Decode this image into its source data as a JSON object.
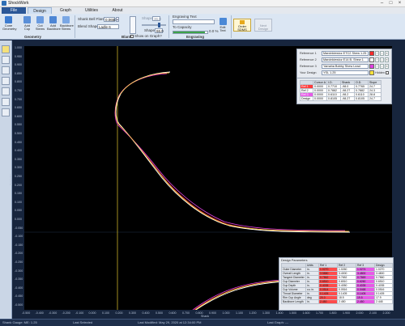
{
  "app": {
    "title": "ShockWork"
  },
  "tabs": [
    {
      "label": "File"
    },
    {
      "label": "Design"
    },
    {
      "label": "Graph"
    },
    {
      "label": "Utilities"
    },
    {
      "label": "About"
    }
  ],
  "ribbon": {
    "buttons": [
      {
        "label": "Cone Geometry"
      },
      {
        "label": "Add Cup"
      },
      {
        "label": "Cut Stems"
      },
      {
        "label": "Add Backbore"
      },
      {
        "label": "Backbore Stems"
      }
    ],
    "group_geometry": "Geometry",
    "shank_label": "Shank Bell Flare:",
    "shank_value": "0.0650",
    "blend_label": "Blend Shape:",
    "blend_value": "Ladle 6",
    "shape_label": "Shape:",
    "shape_value": "36.0",
    "shape2_label": "Shape:",
    "shape2_value": "66.0",
    "group_blank": "Blank",
    "show_origin": "Show on Graph?",
    "eng_title": "Engraving Text",
    "eng_capacity": "To Capacity",
    "eng_progress": 0.92,
    "eng_percent": "0.0 %",
    "eng_button": "Edit Text",
    "group_engraving": "Engraving",
    "order_button": "Order SDMS",
    "next_button": "Next Design"
  },
  "axes": {
    "x_ticks": [
      "-0.500",
      "-0.400",
      "-0.300",
      "-0.200",
      "-0.100",
      "0.000",
      "0.100",
      "0.200",
      "0.300",
      "0.400",
      "0.500",
      "0.600",
      "0.700",
      "0.800",
      "0.900",
      "1.000",
      "1.100",
      "1.200",
      "1.300",
      "1.400",
      "1.500",
      "1.600",
      "1.700",
      "1.800",
      "1.900",
      "2.000",
      "2.100",
      "2.200"
    ],
    "y_ticks": [
      "1.000",
      "0.950",
      "0.900",
      "0.850",
      "0.800",
      "0.750",
      "0.700",
      "0.650",
      "0.600",
      "0.550",
      "0.500",
      "0.450",
      "0.400",
      "0.350",
      "0.300",
      "0.250",
      "0.200",
      "0.150",
      "0.100",
      "0.050",
      "0.000",
      "-0.050",
      "-0.100",
      "-0.150",
      "-0.200",
      "-0.250",
      "-0.300",
      "-0.350",
      "-0.400",
      "-0.450",
      "-0.500"
    ],
    "x_label": "Shank",
    "y_label": "Diameter"
  },
  "reference_panel": {
    "rows": [
      {
        "label": "Reference 1",
        "value": "Marcinkiewicz ETC2 Shew 1.25",
        "color": "#ff2a2a"
      },
      {
        "label": "Reference 2",
        "value": "Marcinkiewicz E14 B. Shew 1",
        "color": "#ffffff"
      },
      {
        "label": "Reference 3",
        "value": "Yamaha Bobby Shew Lead",
        "color": "#e03fe0"
      },
      {
        "label": "Your Design",
        "value": "YSL 1.25",
        "color": "#ffe23a",
        "extra": "Hidden"
      }
    ]
  },
  "compare_table": {
    "header": [
      "",
      "Cursor ∆",
      "I.D.",
      "Shank",
      "O.D.",
      "Slope"
    ],
    "rows": [
      {
        "name": "Ref 1",
        "cells": [
          "0.0000",
          "0.7710",
          "-98.0",
          "0.7765",
          "24.7"
        ],
        "color": "#ff3c3c"
      },
      {
        "name": "Ref 2",
        "cells": [
          "0.0000",
          "0.7882",
          "-98.27",
          "0.7882",
          "24.3"
        ],
        "color": "#ffffff"
      },
      {
        "name": "Ref 3",
        "cells": [
          "0.0000",
          "0.6110",
          "-98.2",
          "0.6110",
          "28.8"
        ],
        "color": "#e85ae8"
      },
      {
        "name": "Design",
        "cells": [
          "0.0000",
          "0.8105",
          "-98.27",
          "0.8105",
          "24.7"
        ],
        "color": "#ffffff"
      }
    ]
  },
  "design_panel": {
    "title": "Design Parameters",
    "header": [
      "",
      "Units",
      "Ref 1",
      "Ref 2",
      "Ref 3",
      "Design"
    ],
    "rows": [
      {
        "name": "Outer Diameter",
        "unit": "in.",
        "v": [
          "1.0270",
          "1.0260",
          "1.0274",
          "1.0270"
        ]
      },
      {
        "name": "Overall Length",
        "unit": "in.",
        "v": [
          "3.5880",
          "3.4000",
          "3.4800",
          "3.4800"
        ]
      },
      {
        "name": "Tangent Diameter",
        "unit": "in.",
        "v": [
          "0.7862",
          "0.7652",
          "0.7869",
          "0.7860"
        ]
      },
      {
        "name": "Cup Diameter",
        "unit": "in.",
        "v": [
          "0.6510",
          "0.6510",
          "0.6260",
          "0.6510"
        ]
      },
      {
        "name": "Cup Depth",
        "unit": "in.",
        "v": [
          "0.4035",
          "0.4050",
          "0.4035",
          "0.4035"
        ]
      },
      {
        "name": "Cup Volume",
        "unit": "cu. in.",
        "v": [
          "0.0514",
          "0.0516",
          "0.0468",
          "0.0516"
        ]
      },
      {
        "name": "Throat Diameter",
        "unit": "in.",
        "v": [
          "0.1405",
          "0.1405",
          "0.1405",
          "0.1405"
        ]
      },
      {
        "name": "Rim Cup Angle",
        "unit": "deg",
        "v": [
          "20.0",
          "18.5",
          "19.5",
          "17.9"
        ]
      },
      {
        "name": "Backbore Length",
        "unit": "in.",
        "v": [
          "2.450",
          "2.450",
          "2.450",
          "2.448"
        ]
      }
    ]
  },
  "status": {
    "left": "Shank Gauge: ME: 1.25",
    "mid": "Last Selected",
    "right1": "Last Modified: May 29, 2020 at 12:34:00 PM",
    "right2": "Last Graph: ---"
  }
}
